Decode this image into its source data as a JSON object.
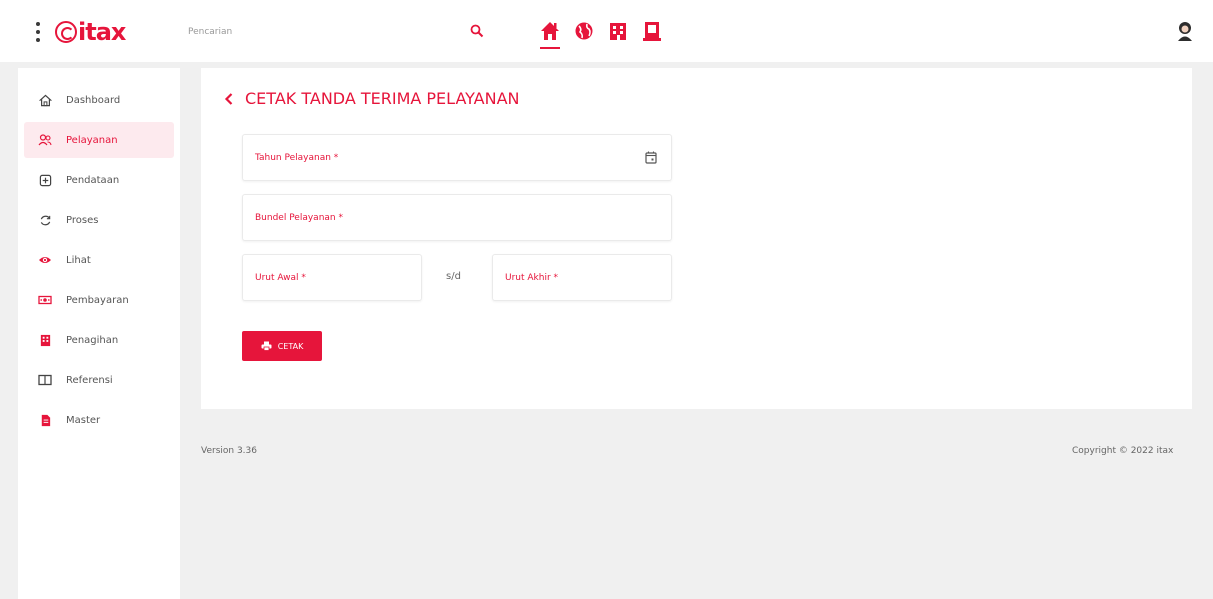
{
  "app": {
    "logo_text": "itax",
    "brand_color": "#e6153b"
  },
  "search": {
    "placeholder": "Pencarian",
    "icon": "search-icon"
  },
  "topnav": [
    {
      "icon": "home-icon",
      "active": true
    },
    {
      "icon": "globe-icon",
      "active": false
    },
    {
      "icon": "building-icon",
      "active": false
    },
    {
      "icon": "document-icon",
      "active": false
    }
  ],
  "sidebar": {
    "items": [
      {
        "label": "Dashboard",
        "icon": "home-outline-icon",
        "active": false
      },
      {
        "label": "Pelayanan",
        "icon": "users-icon",
        "active": true
      },
      {
        "label": "Pendataan",
        "icon": "plus-square-icon",
        "active": false
      },
      {
        "label": "Proses",
        "icon": "refresh-icon",
        "active": false
      },
      {
        "label": "Lihat",
        "icon": "eye-icon",
        "active": false
      },
      {
        "label": "Pembayaran",
        "icon": "cash-icon",
        "active": false
      },
      {
        "label": "Penagihan",
        "icon": "building-icon",
        "active": false
      },
      {
        "label": "Referensi",
        "icon": "book-icon",
        "active": false
      },
      {
        "label": "Master",
        "icon": "file-icon",
        "active": false
      }
    ]
  },
  "main": {
    "title": "CETAK TANDA TERIMA PELAYANAN",
    "fields": {
      "tahun": "Tahun Pelayanan *",
      "bundel": "Bundel Pelayanan *",
      "awal": "Urut Awal *",
      "akhir": "Urut Akhir *"
    },
    "separator": "s/d",
    "print_button": "CETAK"
  },
  "footer": {
    "version": "Version 3.36",
    "copyright": "Copyright © 2022 itax"
  }
}
